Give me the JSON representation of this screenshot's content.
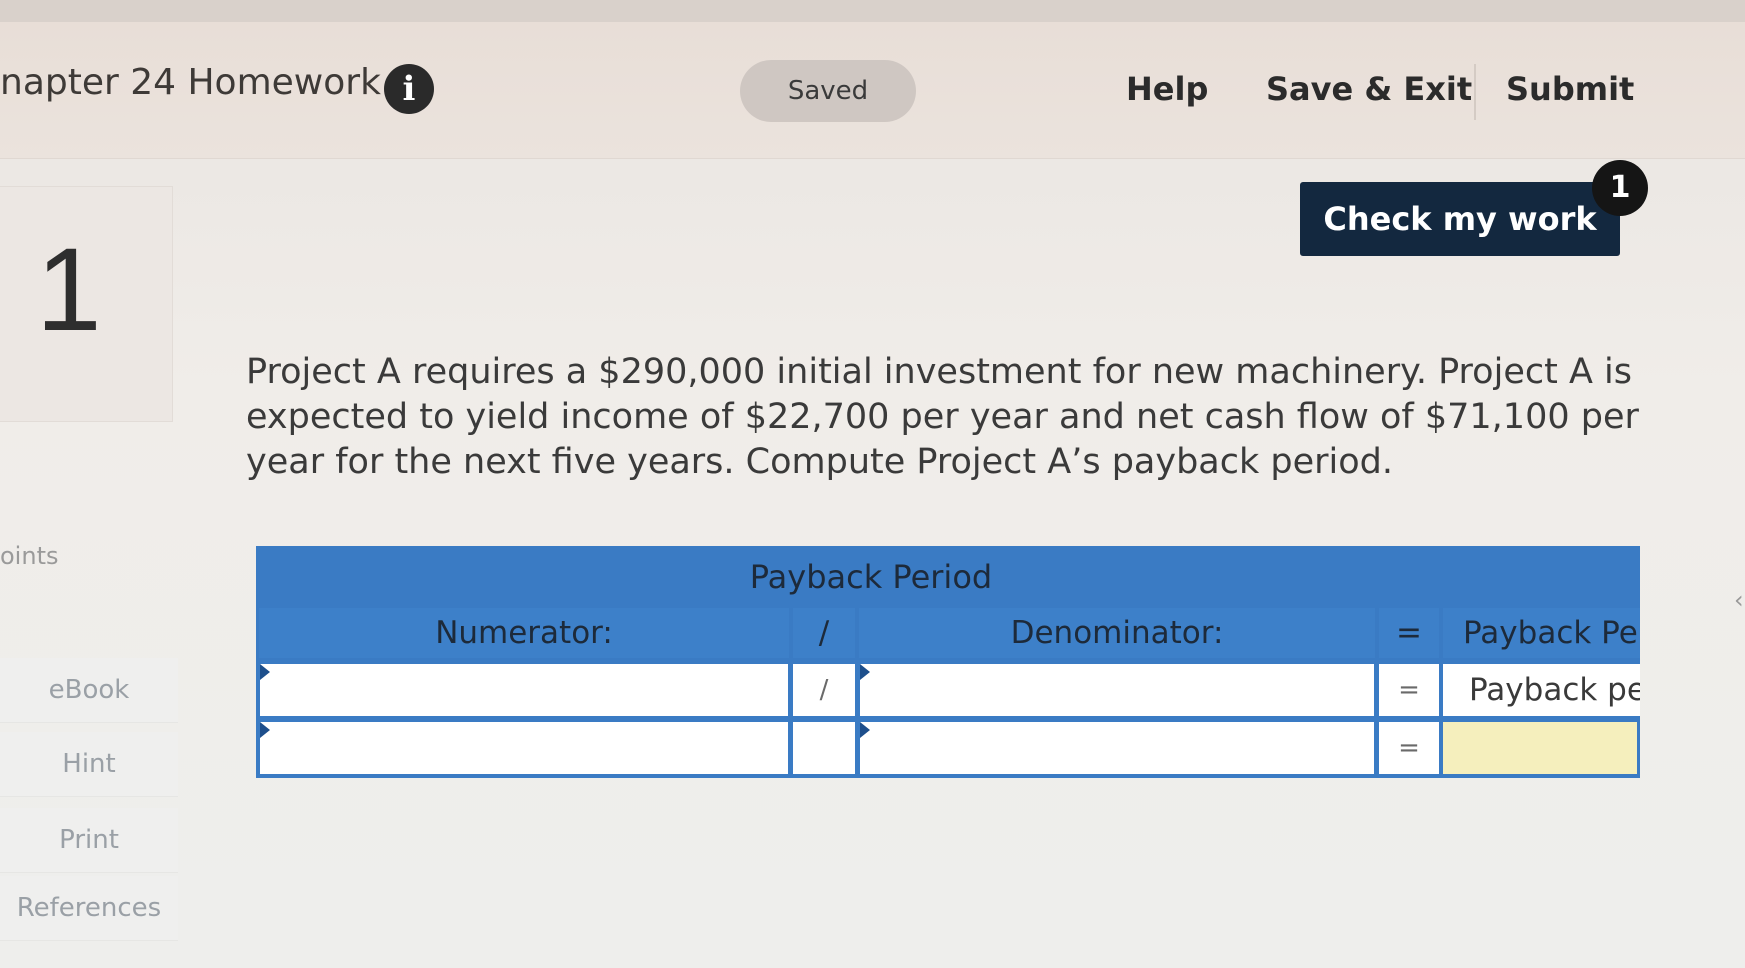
{
  "header": {
    "assignment_title": "napter 24 Homework",
    "info_icon": "info-icon",
    "saved_label": "Saved",
    "help_label": "Help",
    "save_exit_label": "Save & Exit",
    "submit_label": "Submit"
  },
  "check_work": {
    "label": "Check my work",
    "badge_count": "1"
  },
  "question": {
    "number": "1",
    "text": "Project A requires a $290,000 initial investment for new machinery. Project A is expected to yield income of $22,700 per year and net cash flow of $71,100 per year for the next five years. Compute Project A’s payback period."
  },
  "sidebar": {
    "points_label": "oints",
    "items": [
      {
        "label": "eBook"
      },
      {
        "label": "Hint"
      },
      {
        "label": "Print"
      },
      {
        "label": "References"
      }
    ]
  },
  "payback_table": {
    "title": "Payback Period",
    "headers": {
      "numerator": "Numerator:",
      "divide": "/",
      "denominator": "Denominator:",
      "equals": "=",
      "result": "Payback Pe"
    },
    "rows": [
      {
        "numerator_value": "",
        "divide": "/",
        "denominator_value": "",
        "equals": "=",
        "result": "Payback pe"
      },
      {
        "numerator_value": "",
        "divide": "",
        "denominator_value": "",
        "equals": "=",
        "result": ""
      }
    ]
  },
  "colors": {
    "table_blue": "#3a7bc4",
    "check_button": "#13283f",
    "answer_yellow": "#f5efbd"
  }
}
